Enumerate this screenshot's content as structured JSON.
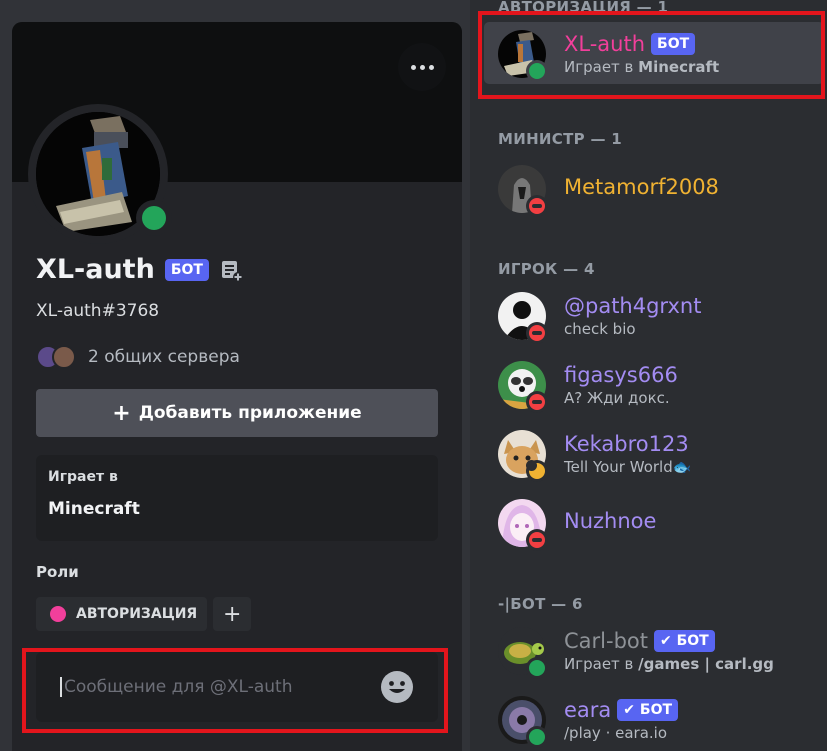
{
  "profile": {
    "username": "XL-auth",
    "bot_label": "БОТ",
    "tag": "XL-auth#3768",
    "mutual_servers": "2 общих сервера",
    "add_app_label": "Добавить приложение",
    "activity_title": "Играет в",
    "activity_game": "Minecraft",
    "roles_title": "Роли",
    "role_name": "АВТОРИЗАЦИЯ",
    "role_color": "#f23f9b",
    "message_placeholder": "Сообщение для @XL-auth",
    "status_color": "#23a55a"
  },
  "members": {
    "sections": [
      {
        "title": "АВТОРИЗАЦИЯ — 1"
      },
      {
        "title": "МИНИСТР — 1"
      },
      {
        "title": "ИГРОК — 4"
      },
      {
        "title": "-|БОТ — 6"
      }
    ],
    "items": [
      {
        "name": "XL-auth",
        "name_color": "#f23f9b",
        "badge": "БОТ",
        "sub_prefix": "Играет в ",
        "sub_bold": "Minecraft",
        "status": "online",
        "icon": "minecraft-avatar"
      },
      {
        "name": "Metamorf2008",
        "name_color": "#f0b232",
        "sub": "",
        "status": "dnd",
        "icon": "knight-avatar"
      },
      {
        "name": "@path4grxnt",
        "name_color": "#a38cf2",
        "sub": "check bio",
        "status": "dnd",
        "icon": "silhouette-avatar"
      },
      {
        "name": "figasys666",
        "name_color": "#a38cf2",
        "sub": "А? Жди докс.",
        "status": "dnd",
        "icon": "raccoon-avatar"
      },
      {
        "name": "Kekabro123",
        "name_color": "#a38cf2",
        "sub": "Tell Your World",
        "sub_emoji": "🐟",
        "status": "idle",
        "icon": "cat-avatar"
      },
      {
        "name": "Nuzhnoe",
        "name_color": "#a38cf2",
        "sub": "",
        "status": "dnd",
        "icon": "anime-avatar"
      },
      {
        "name": "Carl-bot",
        "name_color": "#8e9297",
        "badge": "✔ БОТ",
        "sub_prefix": "Играет в ",
        "sub_bold": "/games | carl.gg",
        "status": "online",
        "icon": "turtle-avatar"
      },
      {
        "name": "eara",
        "name_color": "#a38cf2",
        "badge": "✔ БОТ",
        "sub": "/play · eara.io",
        "status": "online",
        "icon": "disc-avatar"
      }
    ]
  }
}
